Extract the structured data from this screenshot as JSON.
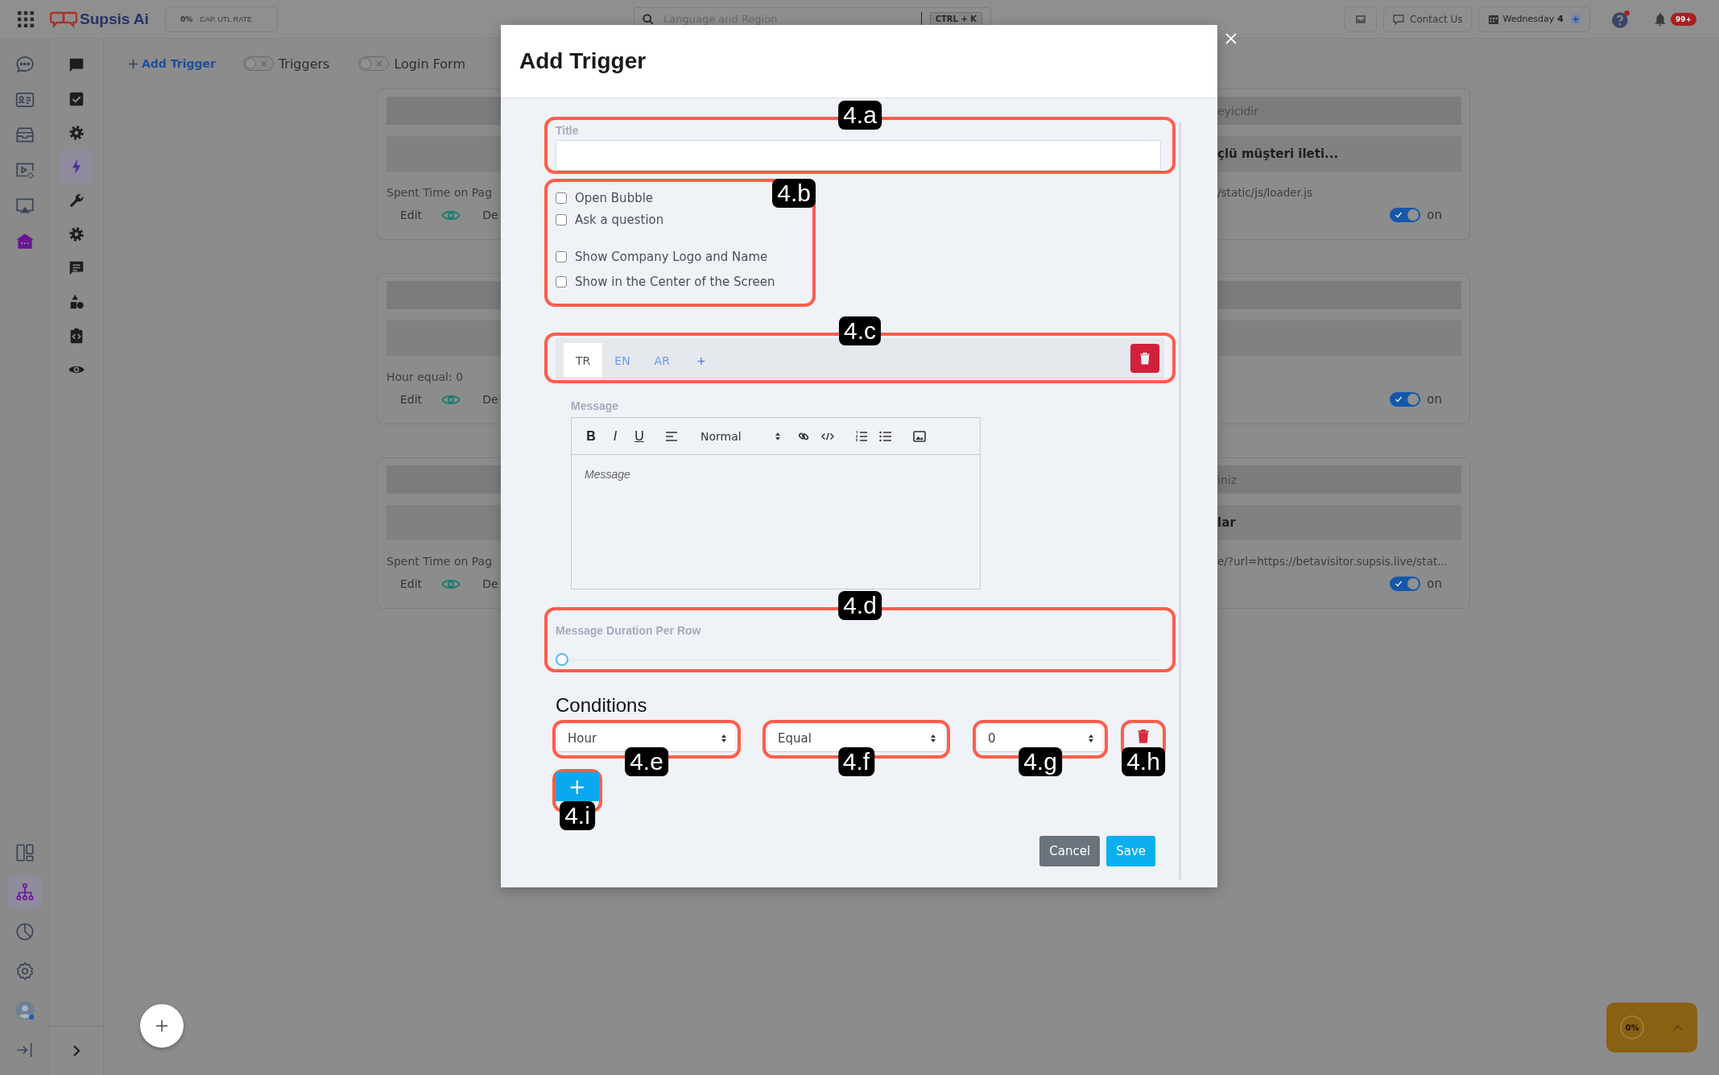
{
  "top_bar": {
    "brand": "Supsis Ai",
    "meter": {
      "value": "0%",
      "label": "CAP. UTL RATE"
    },
    "search": {
      "placeholder": "Language and Region",
      "shortcut": "CTRL + K"
    },
    "contact": "Contact Us",
    "date": {
      "day": "Wednesday",
      "number": "4"
    },
    "notifications": "99+"
  },
  "rail": {
    "top": [
      {
        "kind": "chat-bubble",
        "selected": false
      },
      {
        "kind": "contact-card",
        "selected": false
      },
      {
        "kind": "tray",
        "selected": false
      },
      {
        "kind": "video-gear",
        "selected": false
      },
      {
        "kind": "monitor",
        "selected": false
      },
      {
        "kind": "house",
        "selected": true
      }
    ],
    "bottom": [
      {
        "kind": "layout",
        "selected": false
      },
      {
        "kind": "hierarchy",
        "selected": true
      },
      {
        "kind": "pie-chart",
        "selected": false
      },
      {
        "kind": "settings",
        "selected": false
      },
      {
        "kind": "avatar",
        "selected": false
      },
      {
        "kind": "logout",
        "selected": false
      }
    ]
  },
  "sub_rail": [
    {
      "kind": "message",
      "selected": false
    },
    {
      "kind": "checkbox",
      "selected": false
    },
    {
      "kind": "settings",
      "selected": false
    },
    {
      "kind": "bolt",
      "selected": true
    },
    {
      "kind": "wrench",
      "selected": false
    },
    {
      "kind": "settings",
      "selected": false
    },
    {
      "kind": "comment",
      "selected": false
    },
    {
      "kind": "shapes",
      "selected": false
    },
    {
      "kind": "code-file",
      "selected": false
    },
    {
      "kind": "eye",
      "selected": false
    }
  ],
  "toolbar": {
    "add": "Add Trigger",
    "toggles": [
      {
        "label": "Triggers",
        "on": false
      },
      {
        "label": "Login Form",
        "on": false
      }
    ]
  },
  "cards": [
    {
      "title_end": "eyicidir",
      "message_end": "çlü müşteri ileti...",
      "condition": "Spent Time on Pag",
      "url_end": "/static/js/loader.js",
      "edit": "Edit",
      "delete_start": "De",
      "on": true,
      "state_label": "on"
    },
    {
      "condition": "Hour equal: 0",
      "edit": "Edit",
      "delete_start": "De",
      "on": true,
      "state_label": "on"
    },
    {
      "title_end": "iniz",
      "message_end": "lar",
      "condition": "Spent Time on Pag",
      "url_end": "e/?url=https://betavisitor.supsis.live/stat...",
      "edit": "Edit",
      "delete_start": "De",
      "on": true,
      "state_label": "on"
    }
  ],
  "modal": {
    "title": "Add Trigger",
    "title_field": {
      "annotation": "4.a",
      "label": "Title"
    },
    "options": {
      "annotation": "4.b",
      "items": [
        {
          "label": "Open Bubble",
          "checked": false
        },
        {
          "label": "Ask a question",
          "checked": false
        },
        {
          "label": "Show Company Logo and Name",
          "checked": false
        },
        {
          "label": "Show in the Center of the Screen",
          "checked": false
        }
      ]
    },
    "language_tabs": {
      "annotation": "4.c",
      "tabs": [
        {
          "label": "TR",
          "selected": true
        },
        {
          "label": "EN",
          "selected": false
        },
        {
          "label": "AR",
          "selected": false
        }
      ],
      "add": "+"
    },
    "message": {
      "label": "Message",
      "bold": "B",
      "italic": "I",
      "underline": "U",
      "format": "Normal",
      "placeholder": "Message"
    },
    "duration": {
      "annotation": "4.d",
      "label": "Message Duration Per Row",
      "level": 0
    },
    "conditions": {
      "heading": "Conditions",
      "rows": [
        {
          "field": "Hour",
          "field_annotation": "4.e",
          "operator": "Equal",
          "operator_annotation": "4.f",
          "value": "0",
          "value_annotation": "4.g",
          "delete_annotation": "4.h"
        }
      ],
      "add": "+",
      "add_annotation": "4.i"
    },
    "buttons": [
      {
        "label": "Cancel",
        "kind": "secondary"
      },
      {
        "label": "Save",
        "kind": "primary"
      }
    ]
  },
  "widget": {
    "value": "0%"
  }
}
